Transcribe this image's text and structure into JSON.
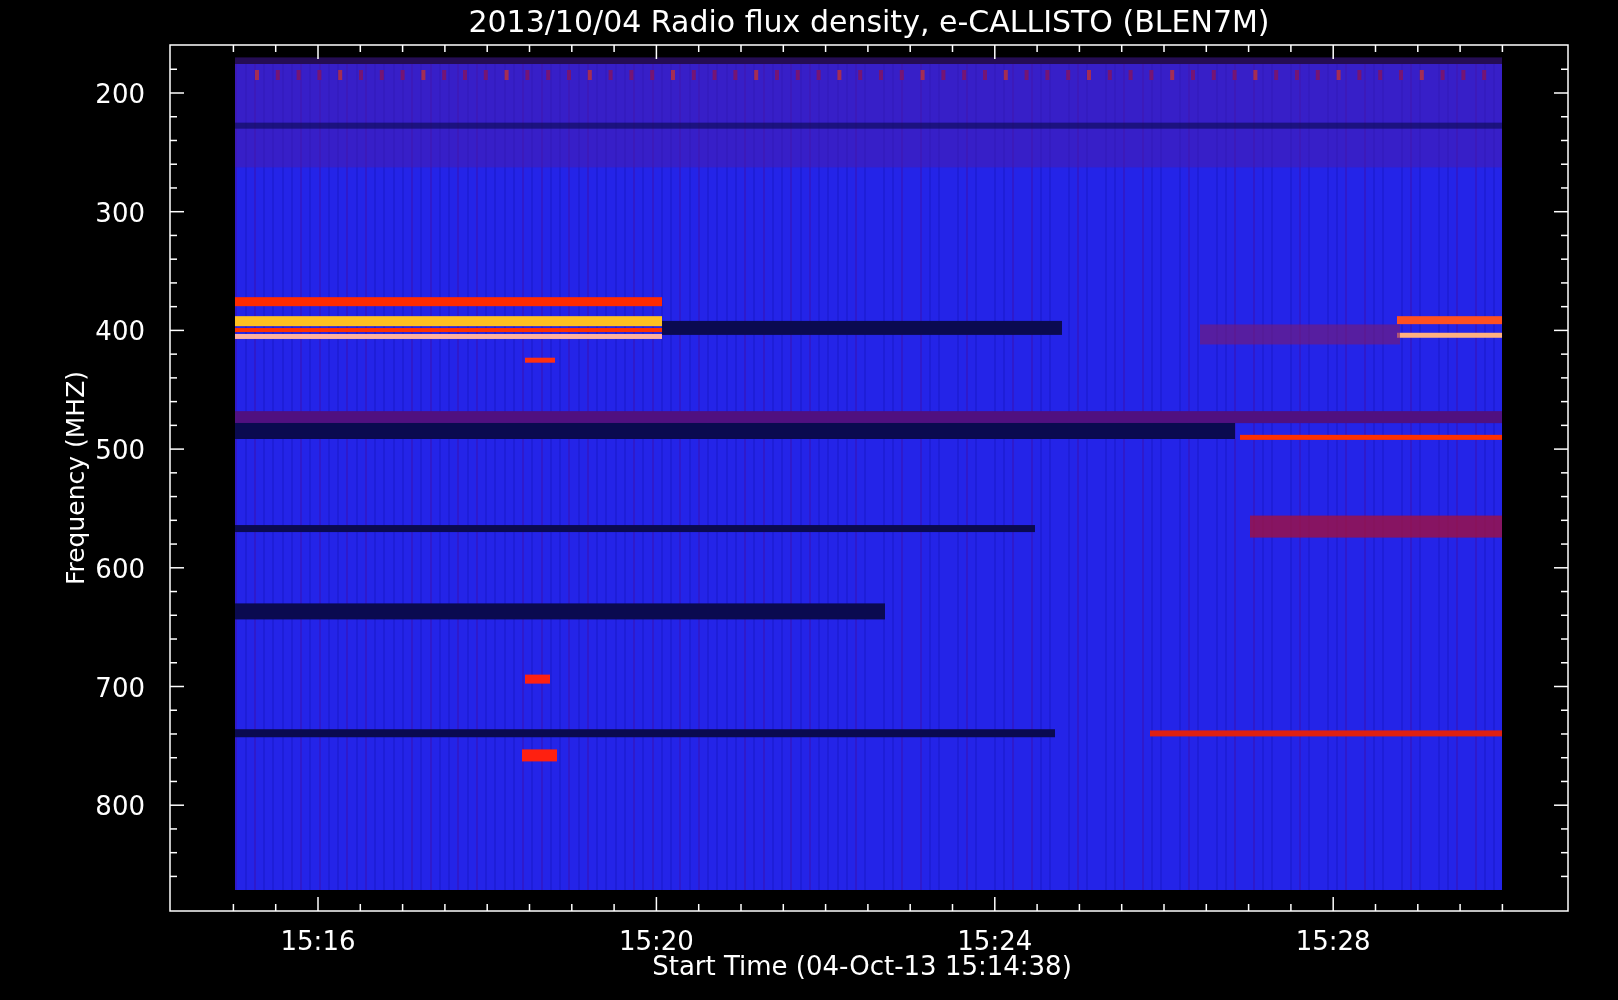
{
  "title": "2013/10/04  Radio flux density, e-CALLISTO (BLEN7M)",
  "y_axis": {
    "label": "Frequency (MHZ)",
    "ticks": [
      "200",
      "300",
      "400",
      "500",
      "600",
      "700",
      "800"
    ]
  },
  "x_axis": {
    "label": "Start Time (04-Oct-13 15:14:38)",
    "ticks": [
      "15:16",
      "15:20",
      "15:24",
      "15:28"
    ]
  }
}
